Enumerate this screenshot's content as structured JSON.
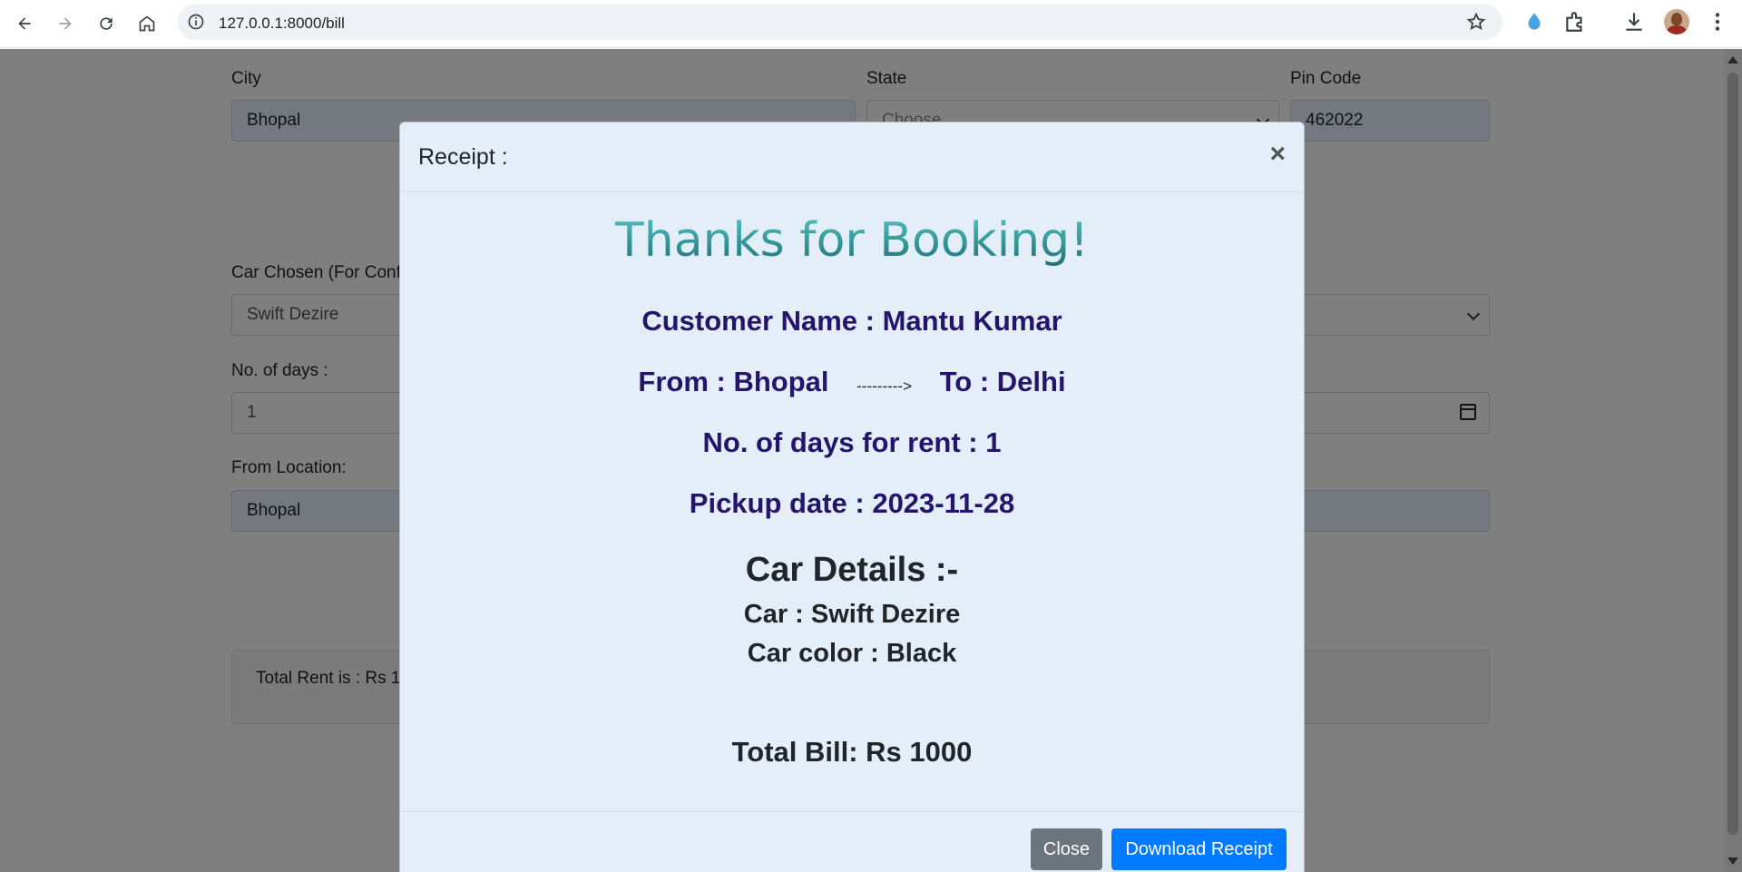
{
  "browser": {
    "url": "127.0.0.1:8000/bill"
  },
  "form": {
    "city_label": "City",
    "city_value": "Bhopal",
    "state_label": "State",
    "state_value": "Choose...",
    "pin_label": "Pin Code",
    "pin_value": "462022",
    "car_label": "Car Chosen (For Confirmation)",
    "car_value": "Swift Dezire",
    "days_label": "No. of days :",
    "days_value": "1",
    "from_label": "From Location:",
    "from_value": "Bhopal",
    "total_text": "Total Rent is : Rs 1000"
  },
  "modal": {
    "title": "Receipt :",
    "close_symbol": "×",
    "thanks": "Thanks for Booking!",
    "customer_line": "Customer Name : Mantu Kumar",
    "from_text": "From : Bhopal",
    "arrow_text": "--------->",
    "to_text": "To : Delhi",
    "days_line": "No. of days for rent : 1",
    "pickup_line": "Pickup date : 2023-11-28",
    "details_title": "Car Details :-",
    "car_line": "Car : Swift Dezire",
    "color_line": "Car color : Black",
    "bill_line": "Total Bill: Rs 1000",
    "close_button": "Close",
    "download_button": "Download Receipt"
  },
  "colors": {
    "heading_gradient_top": "#4fc3c0",
    "heading_gradient_bottom": "#1f6f74",
    "info_text": "#24146a",
    "modal_bg": "#e3eef9",
    "close_btn": "#6c757d",
    "download_btn": "#007bff"
  }
}
